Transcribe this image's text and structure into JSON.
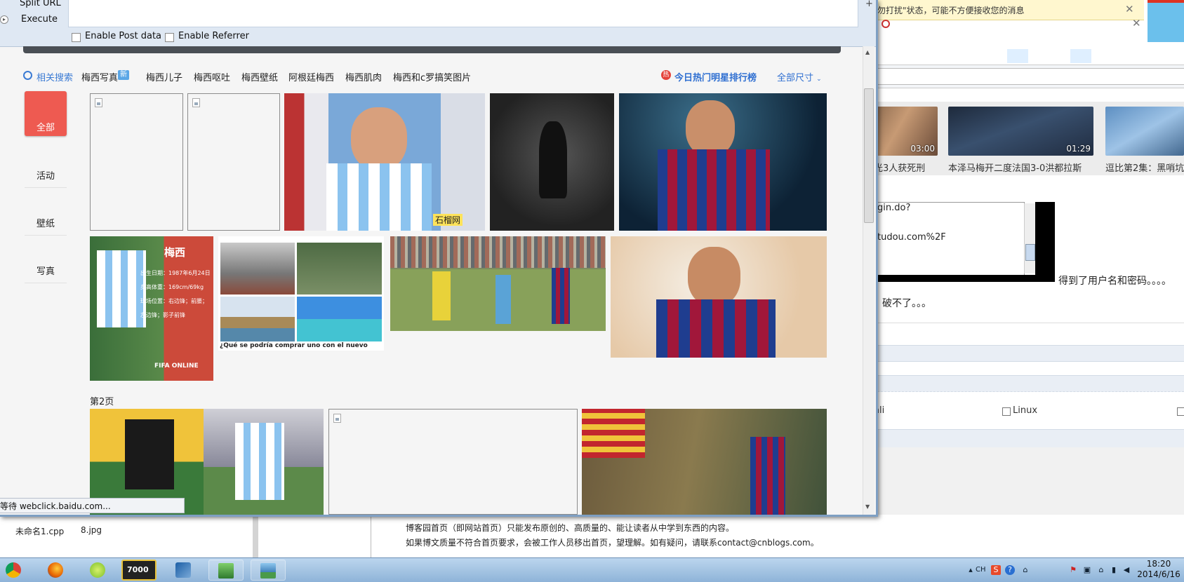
{
  "hackbar": {
    "menu_split": "Split URL",
    "menu_execute": "Execute",
    "enable_post": "Enable Post data",
    "enable_referrer": "Enable Referrer",
    "plus": "+"
  },
  "related": {
    "title": "相关搜索",
    "new_badge": "新",
    "links": [
      "梅西写真",
      "梅西儿子",
      "梅西呕吐",
      "梅西壁纸",
      "阿根廷梅西",
      "梅西肌肉",
      "梅西和c罗搞笑图片"
    ],
    "hot_icon": "热",
    "hot_rank": "今日热门明星排行榜",
    "size_filter": "全部尺寸"
  },
  "nav": {
    "all": "全部",
    "items": [
      "活动",
      "壁纸",
      "写真"
    ]
  },
  "images": {
    "info_card_title": "梅西",
    "info_lines": [
      "出生日期：1987年6月24日",
      "身高体重：169cm/69kg",
      "球场位置：右边锋；前腰；",
      "左边锋；影子前锋"
    ],
    "info_brand": "FIFA ONLINE",
    "watermark": "石榴网",
    "collage_caption": "¿Qué se podría comprar uno con el nuevo"
  },
  "page2_label": "第2页",
  "status_text": "等待 webclick.baidu.com...",
  "bg_window": {
    "notification": "勿打扰\"状态，可能不方便接收您的消息",
    "videos": [
      {
        "duration": "03:00",
        "caption": "光3人获死刑"
      },
      {
        "duration": "01:29",
        "caption": "本泽马梅开二度法国3-0洪都拉斯"
      },
      {
        "duration": "",
        "caption": "逗比第2集：黑哨坑"
      }
    ],
    "textbox_line1": "gin.do?",
    "textbox_line2": "tudou.com%2F",
    "after_box": "得到了用户名和密码。。。。",
    "line2": "破不了。。。",
    "kali": "ali",
    "linux": "Linux"
  },
  "lower": {
    "file1": "未命名1.cpp",
    "file2": "8.jpg",
    "blog_line1": "博客园首页（即网站首页）只能发布原创的、高质量的、能让读者从中学到东西的内容。",
    "blog_line2": "如果博文质量不符合首页要求，会被工作人员移出首页，望理解。如有疑问，请联系contact@cnblogs.com。"
  },
  "taskbar": {
    "app_7000": "7000",
    "tray_lang": "CH",
    "tray_s": "S",
    "tray_q": "?",
    "time": "18:20",
    "date": "2014/6/16"
  }
}
